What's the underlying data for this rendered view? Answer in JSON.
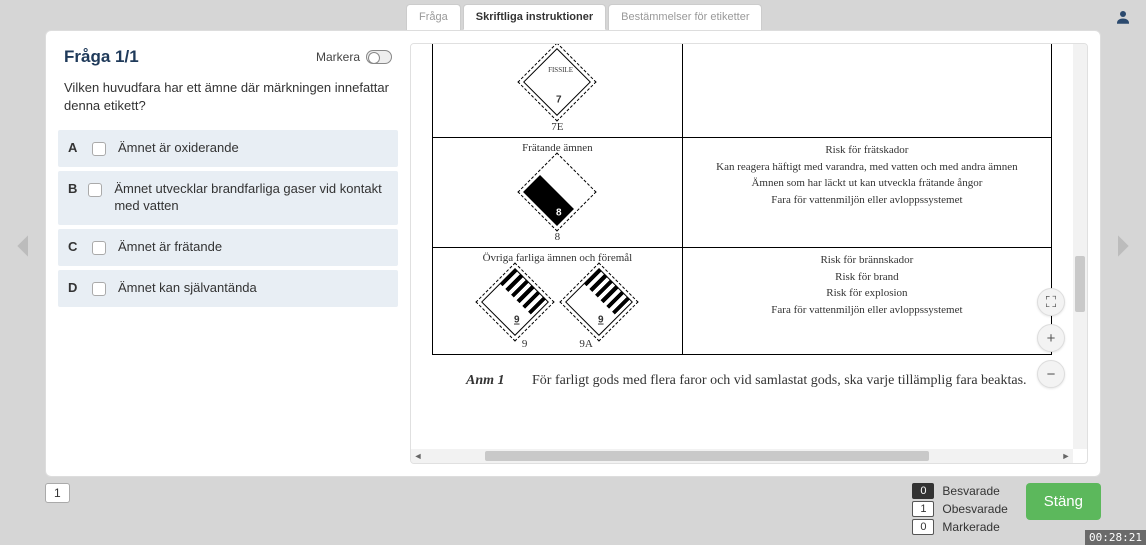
{
  "tabs": {
    "t1": "Fråga",
    "t2": "Skriftliga instruktioner",
    "t3": "Bestämmelser för etiketter"
  },
  "question": {
    "title": "Fråga 1/1",
    "mark_label": "Markera",
    "text": "Vilken huvudfara har ett ämne där märkningen innefattar denna etikett?",
    "options": {
      "a": {
        "letter": "A",
        "text": "Ämnet är oxiderande"
      },
      "b": {
        "letter": "B",
        "text": "Ämnet utvecklar brandfarliga gaser vid kontakt med vatten"
      },
      "c": {
        "letter": "C",
        "text": "Ämnet är frätande"
      },
      "d": {
        "letter": "D",
        "text": "Ämnet kan självantända"
      }
    }
  },
  "doc": {
    "row1": {
      "code": "7E",
      "fissile": "FISSILE"
    },
    "row2": {
      "header": "Frätande ämnen",
      "code": "8",
      "risks": {
        "r1": "Risk för frätskador",
        "r2": "Kan reagera häftigt med varandra, med vatten och med andra ämnen",
        "r3": "Ämnen som har läckt ut kan utveckla frätande ångor",
        "r4": "Fara för vattenmiljön eller avloppssystemet"
      }
    },
    "row3": {
      "header": "Övriga farliga ämnen och föremål",
      "codeA": "9",
      "codeB": "9A",
      "risks": {
        "r1": "Risk för brännskador",
        "r2": "Risk för brand",
        "r3": "Risk för explosion",
        "r4": "Fara för vattenmiljön eller avloppssystemet"
      }
    },
    "note_label": "Anm 1",
    "note_text": "För farligt gods med flera faror och vid samlastat gods, ska varje tillämplig fara beaktas."
  },
  "zoom": {
    "fit": "⛶",
    "plus": "+",
    "minus": "−"
  },
  "footer": {
    "page": "1",
    "answered": {
      "count": "0",
      "label": "Besvarade"
    },
    "unanswered": {
      "count": "1",
      "label": "Obesvarade"
    },
    "marked": {
      "count": "0",
      "label": "Markerade"
    },
    "close": "Stäng",
    "timer": "00:28:21"
  }
}
